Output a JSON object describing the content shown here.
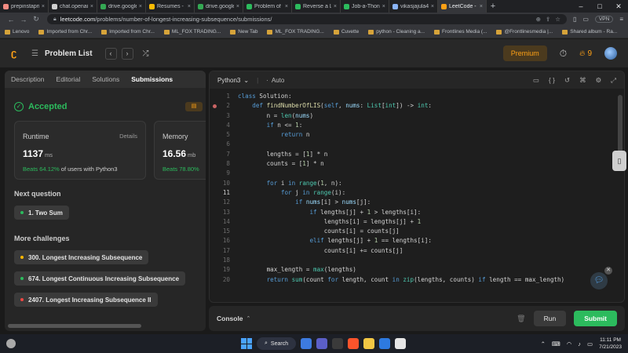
{
  "browser": {
    "tabs": [
      {
        "title": "prepinstaprime.",
        "color": "#f28b82"
      },
      {
        "title": "chat.openai.com",
        "color": "#cfcfcf"
      },
      {
        "title": "drive.google.com",
        "color": "#34a853"
      },
      {
        "title": "Resumes - Googl",
        "color": "#fbbc04"
      },
      {
        "title": "drive.google.com",
        "color": "#34a853"
      },
      {
        "title": "Problem of the D",
        "color": "#2cbb5d"
      },
      {
        "title": "Reverse a Linked",
        "color": "#2cbb5d"
      },
      {
        "title": "Job-a-Thon",
        "color": "#2cbb5d"
      },
      {
        "title": "vikasjajula432 -",
        "color": "#8ab4f8"
      },
      {
        "title": "LeetCode - T",
        "color": "#ffa116",
        "active": true
      }
    ],
    "url_host": "leetcode.com",
    "url_path": "/problems/number-of-longest-increasing-subsequence/submissions/",
    "vpn_label": "VPN",
    "bookmarks": [
      "Lenovo",
      "Imported from Chr...",
      "Imported from Chr...",
      "ML_FOX TRADING...",
      "New Tab",
      "ML_FOX TRADING...",
      "Cuvette",
      "python - Cleaning a...",
      "Frontlines Media (...",
      "@Frontlinesmedia |...",
      "Shared album - Ra..."
    ]
  },
  "header": {
    "title": "Problem List",
    "premium_label": "Premium",
    "streak": "9"
  },
  "left": {
    "tabs": [
      "Description",
      "Editorial",
      "Solutions",
      "Submissions"
    ],
    "status": "Accepted",
    "runtime": {
      "label": "Runtime",
      "details": "Details",
      "value": "1137",
      "unit": "ms",
      "beats": "Beats 64.12%",
      "beats_suffix": "of users with Python3"
    },
    "memory": {
      "label": "Memory",
      "value": "16.56",
      "unit": "mb",
      "beats": "Beats 78.80%"
    },
    "next_question_title": "Next question",
    "next_question": "1. Two Sum",
    "more_title": "More challenges",
    "challenges": [
      {
        "label": "300. Longest Increasing Subsequence",
        "color": "#ffb800"
      },
      {
        "label": "674. Longest Continuous Increasing Subsequence",
        "color": "#2cbb5d"
      },
      {
        "label": "2407. Longest Increasing Subsequence II",
        "color": "#ef4743"
      }
    ]
  },
  "editor": {
    "language": "Python3",
    "mode": "Auto",
    "current_line": 11,
    "lines": [
      "class Solution:",
      "    def findNumberOfLIS(self, nums: List[int]) -> int:",
      "        n = len(nums)",
      "        if n <= 1:",
      "            return n",
      "",
      "        lengths = [1] * n",
      "        counts = [1] * n",
      "",
      "        for i in range(1, n):",
      "            for j in range(i):",
      "                if nums[i] > nums[j]:",
      "                    if lengths[j] + 1 > lengths[i]:",
      "                        lengths[i] = lengths[j] + 1",
      "                        counts[i] = counts[j]",
      "                    elif lengths[j] + 1 == lengths[i]:",
      "                        counts[i] += counts[j]",
      "",
      "        max_length = max(lengths)",
      "        return sum(count for length, count in zip(lengths, counts) if length == max_length)"
    ]
  },
  "console": {
    "label": "Console",
    "run_label": "Run",
    "submit_label": "Submit"
  },
  "taskbar": {
    "search_label": "Search",
    "time": "11:11 PM",
    "date": "7/21/2023"
  }
}
